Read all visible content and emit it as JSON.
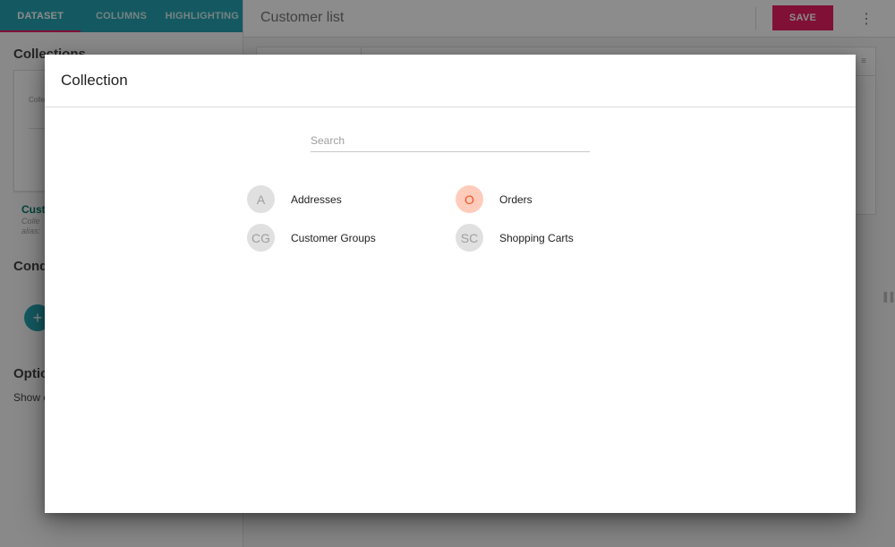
{
  "tabs": [
    {
      "label": "DATASET",
      "active": true
    },
    {
      "label": "COLUMNS",
      "active": false
    },
    {
      "label": "HIGHLIGHTING",
      "active": false
    }
  ],
  "left": {
    "collections_title": "Collections",
    "card_label": "Colle",
    "collection_name": "Custo",
    "collection_sub1": "Colle",
    "collection_sub2": "alias:",
    "conditions_title": "Cond",
    "add_symbol": "+",
    "options_title": "Optio",
    "show_text": "Show c"
  },
  "header": {
    "title": "Customer list",
    "save_label": "SAVE",
    "more_symbol": "⋮"
  },
  "colors": {
    "teal": "#26a3b1",
    "pink": "#e91e63",
    "orange_avatar_bg": "#ffccbc",
    "orange_avatar_fg": "#f4511e"
  },
  "dialog": {
    "title": "Collection",
    "search_placeholder": "Search",
    "items": [
      {
        "initials": "A",
        "label": "Addresses",
        "highlight": false
      },
      {
        "initials": "O",
        "label": "Orders",
        "highlight": true
      },
      {
        "initials": "CG",
        "label": "Customer Groups",
        "highlight": false
      },
      {
        "initials": "SC",
        "label": "Shopping Carts",
        "highlight": false
      }
    ]
  }
}
